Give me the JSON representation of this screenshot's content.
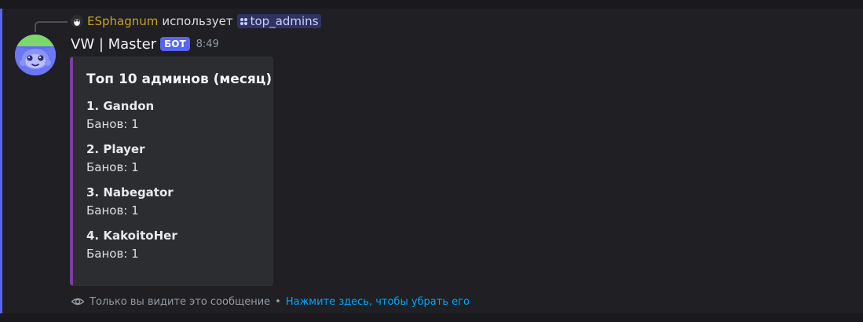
{
  "reply": {
    "user": "ESphagnum",
    "verb": "использует",
    "command": "top_admins"
  },
  "message": {
    "author": "VW | Master",
    "bot_tag": "БОТ",
    "timestamp": "8:49"
  },
  "embed": {
    "title": "Топ 10 админов (месяц)",
    "accent_color": "#7a3fa0",
    "entries": [
      {
        "name": "1. Gandon",
        "value": "Банов: 1"
      },
      {
        "name": "2. Player",
        "value": "Банов: 1"
      },
      {
        "name": "3. Nabegator",
        "value": "Банов: 1"
      },
      {
        "name": "4. KakoitoHer",
        "value": "Банов: 1"
      }
    ]
  },
  "ephemeral": {
    "notice": "Только вы видите это сообщение",
    "separator": "•",
    "dismiss_link": "Нажмите здесь, чтобы убрать его"
  },
  "colors": {
    "brand": "#5865f2",
    "link": "#00a8fc",
    "reply_user": "#c9a227"
  }
}
